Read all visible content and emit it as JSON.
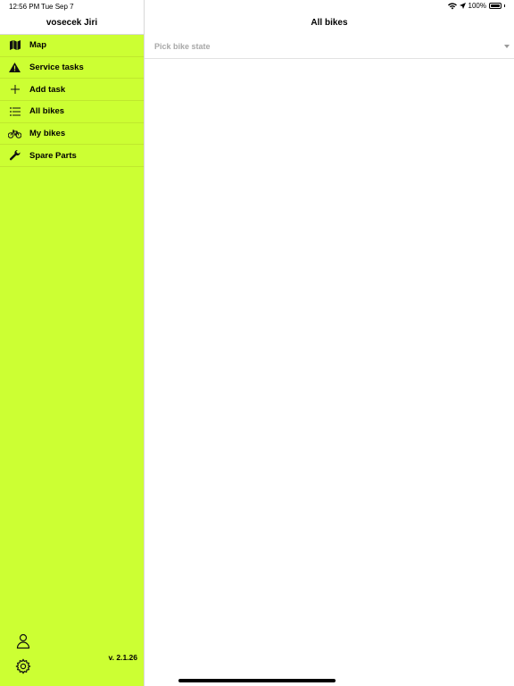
{
  "status": {
    "time": "12:56 PM",
    "date": "Tue Sep 7",
    "battery": "100%",
    "battery_level": 1.0,
    "icons": [
      "wifi-icon",
      "location-arrow-icon",
      "battery-icon"
    ]
  },
  "sidebar": {
    "user_name": "vosecek Jiri",
    "background": "#ccff33",
    "items": [
      {
        "label": "Map",
        "icon": "map-icon"
      },
      {
        "label": "Service tasks",
        "icon": "warning-icon"
      },
      {
        "label": "Add task",
        "icon": "plus-icon"
      },
      {
        "label": "All bikes",
        "icon": "list-icon"
      },
      {
        "label": "My bikes",
        "icon": "bicycle-icon"
      },
      {
        "label": "Spare Parts",
        "icon": "wrench-icon"
      }
    ],
    "footer": {
      "version": "v. 2.1.26",
      "icons": [
        "person-icon",
        "gear-icon"
      ]
    }
  },
  "main": {
    "title": "All bikes",
    "picker": {
      "placeholder": "Pick bike state",
      "icon": "chevron-down-icon"
    }
  }
}
